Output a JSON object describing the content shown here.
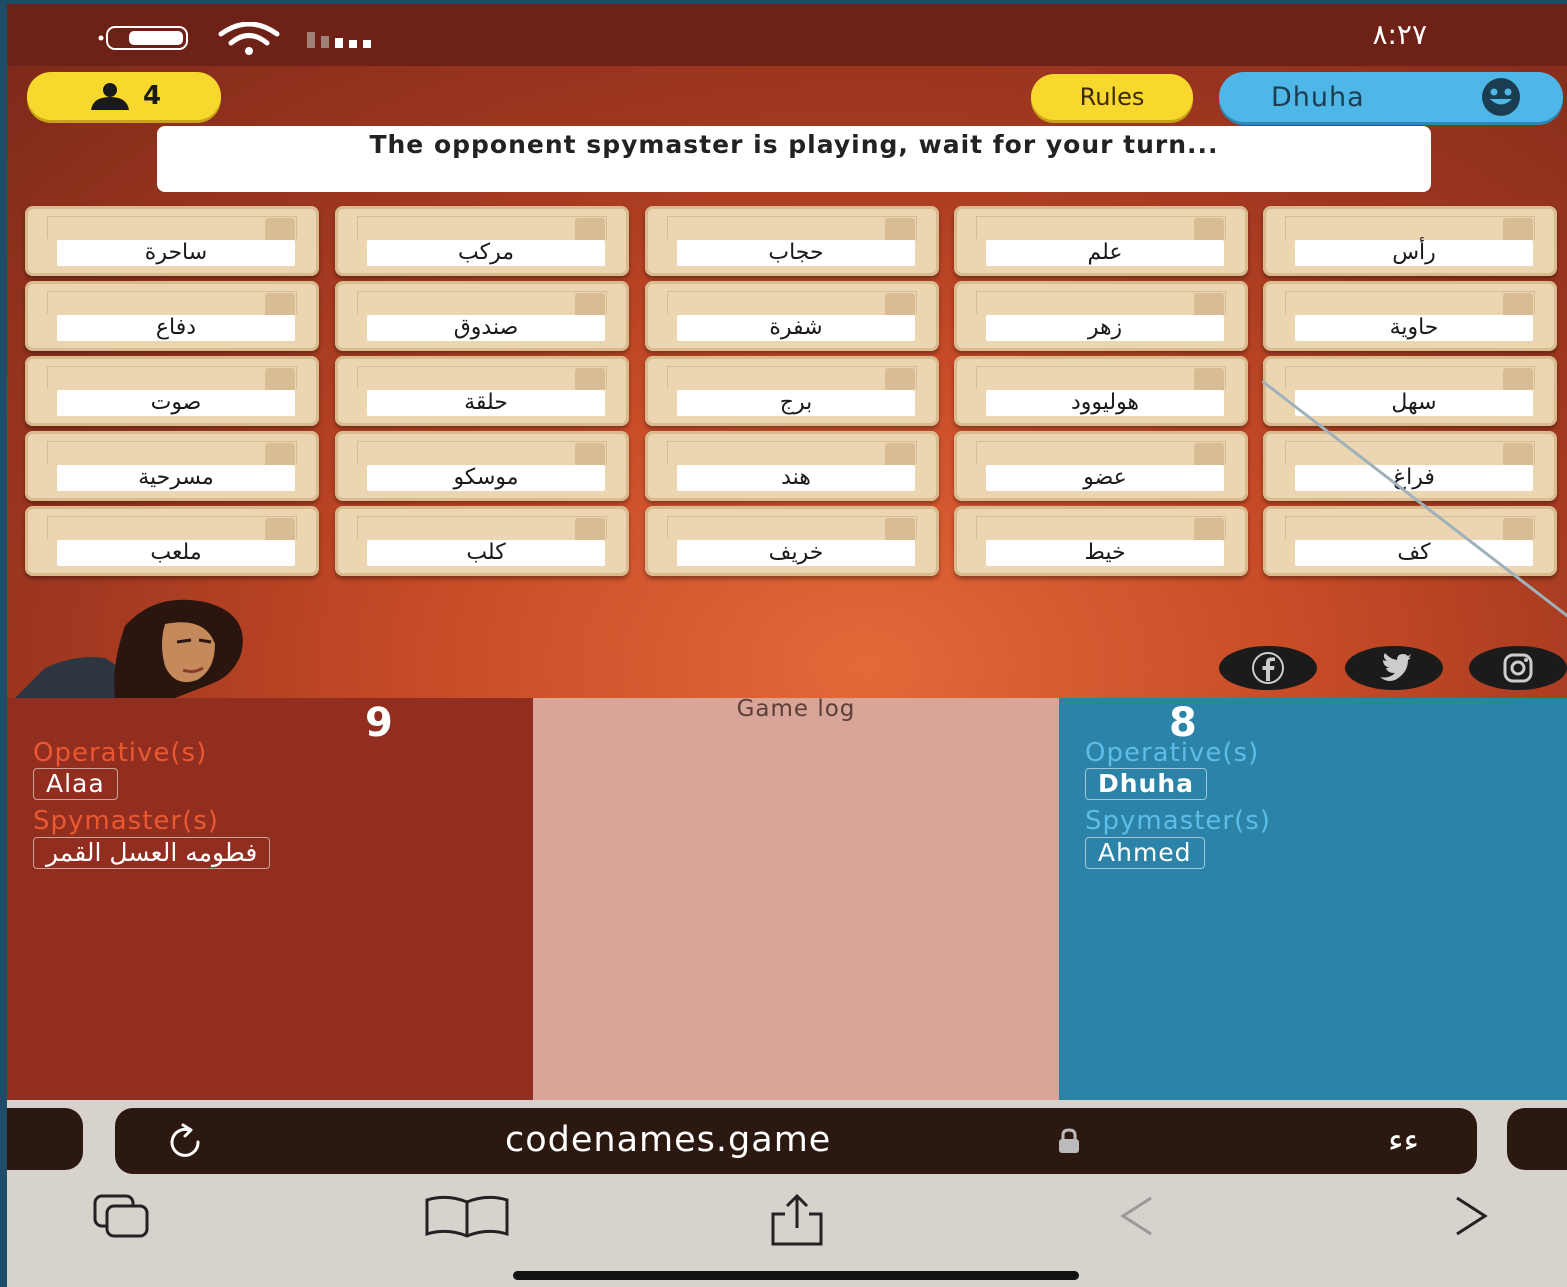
{
  "status_bar": {
    "time": "٨:٢٧"
  },
  "header": {
    "player_count": "4",
    "rules_label": "Rules",
    "user_name": "Dhuha"
  },
  "message": "The opponent spymaster is playing, wait for your turn...",
  "board": {
    "rows": [
      [
        "ساحرة",
        "مركب",
        "حجاب",
        "علم",
        "رأس"
      ],
      [
        "دفاع",
        "صندوق",
        "شفرة",
        "زهر",
        "حاوية"
      ],
      [
        "صوت",
        "حلقة",
        "برج",
        "هوليوود",
        "سهل"
      ],
      [
        "مسرحية",
        "موسكو",
        "هند",
        "عضو",
        "فراغ"
      ],
      [
        "ملعب",
        "كلب",
        "خريف",
        "خيط",
        "كف"
      ]
    ]
  },
  "social": [
    "facebook-icon",
    "twitter-icon",
    "instagram-icon"
  ],
  "red_team": {
    "score": "9",
    "operative_label": "Operative(s)",
    "operatives": [
      "Alaa"
    ],
    "spymaster_label": "Spymaster(s)",
    "spymasters": [
      "فطومه العسل القمر"
    ]
  },
  "game_log": {
    "title": "Game log"
  },
  "blue_team": {
    "score": "8",
    "operative_label": "Operative(s)",
    "operatives": [
      "Dhuha"
    ],
    "spymaster_label": "Spymaster(s)",
    "spymasters": [
      "Ahmed"
    ]
  },
  "browser": {
    "url": "codenames.game",
    "text_size_button": "ﺀﺀ"
  },
  "colors": {
    "red_team": "#912e20",
    "blue_team": "#2c83a8",
    "button_yellow": "#f8d82c",
    "user_blue": "#4fb7e8"
  }
}
